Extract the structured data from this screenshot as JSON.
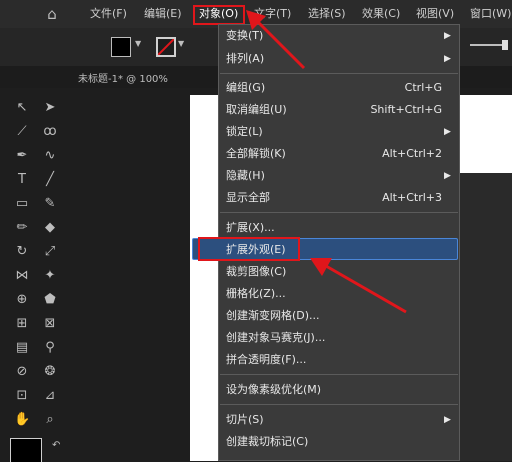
{
  "menubar": {
    "items": [
      {
        "label": "文件(F)"
      },
      {
        "label": "编辑(E)"
      },
      {
        "label": "对象(O)"
      },
      {
        "label": "文字(T)"
      },
      {
        "label": "选择(S)"
      },
      {
        "label": "效果(C)"
      },
      {
        "label": "视图(V)"
      },
      {
        "label": "窗口(W)"
      }
    ]
  },
  "control": {
    "doc_tab": "未标题-1* @ 100%"
  },
  "dropdown": {
    "items": [
      {
        "label": "变换(T)",
        "shortcut": "",
        "submenu": true
      },
      {
        "label": "排列(A)",
        "shortcut": "",
        "submenu": true
      },
      {
        "label": "编组(G)",
        "shortcut": "Ctrl+G",
        "submenu": false
      },
      {
        "label": "取消编组(U)",
        "shortcut": "Shift+Ctrl+G",
        "submenu": false
      },
      {
        "label": "锁定(L)",
        "shortcut": "",
        "submenu": true
      },
      {
        "label": "全部解锁(K)",
        "shortcut": "Alt+Ctrl+2",
        "submenu": false
      },
      {
        "label": "隐藏(H)",
        "shortcut": "",
        "submenu": true
      },
      {
        "label": "显示全部",
        "shortcut": "Alt+Ctrl+3",
        "submenu": false
      },
      {
        "label": "扩展(X)...",
        "shortcut": "",
        "submenu": false
      },
      {
        "label": "扩展外观(E)",
        "shortcut": "",
        "submenu": false
      },
      {
        "label": "裁剪图像(C)",
        "shortcut": "",
        "submenu": false
      },
      {
        "label": "栅格化(Z)...",
        "shortcut": "",
        "submenu": false
      },
      {
        "label": "创建渐变网格(D)...",
        "shortcut": "",
        "submenu": false
      },
      {
        "label": "创建对象马赛克(J)...",
        "shortcut": "",
        "submenu": false
      },
      {
        "label": "拼合透明度(F)...",
        "shortcut": "",
        "submenu": false
      },
      {
        "label": "设为像素级优化(M)",
        "shortcut": "",
        "submenu": false
      },
      {
        "label": "切片(S)",
        "shortcut": "",
        "submenu": true
      },
      {
        "label": "创建裁切标记(C)",
        "shortcut": "",
        "submenu": false
      }
    ]
  },
  "icons": {
    "home": "home-icon",
    "submenu": "chevron-right-icon"
  },
  "colors": {
    "annotation": "#e0161b",
    "highlight": "#2c4f7e",
    "menu_bg": "#3a3a3a"
  }
}
